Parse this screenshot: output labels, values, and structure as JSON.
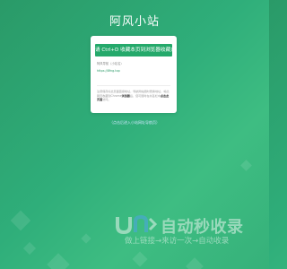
{
  "header": {
    "site_title": "阿风小站"
  },
  "card": {
    "banner_text": "请 Ctrl+D 收藏本页到浏览器收藏夹",
    "site_label": "阿风导航（小站名）",
    "site_url": "https://8fng.top",
    "tip_prefix": "注意保存好此页面链接地址，导航网站随时更换地址，将此网页收藏到Chrome",
    "tip_bold_1": "浏览器",
    "tip_middle": "后，您可随时在书签栏中",
    "tip_bold_2": "点击此页面",
    "tip_suffix": "访问。"
  },
  "enter_link": {
    "label": "（点击后进入小站网址导航页）"
  },
  "watermark": {
    "title": "自动秒收录",
    "slogan": "做上链接→来访一次→自动收录",
    "logo_icon": "logo-icon"
  },
  "colors": {
    "background_start": "#2a9a68",
    "background_end": "#3ebd82",
    "banner": "#25a96b",
    "card": "#ffffff"
  }
}
